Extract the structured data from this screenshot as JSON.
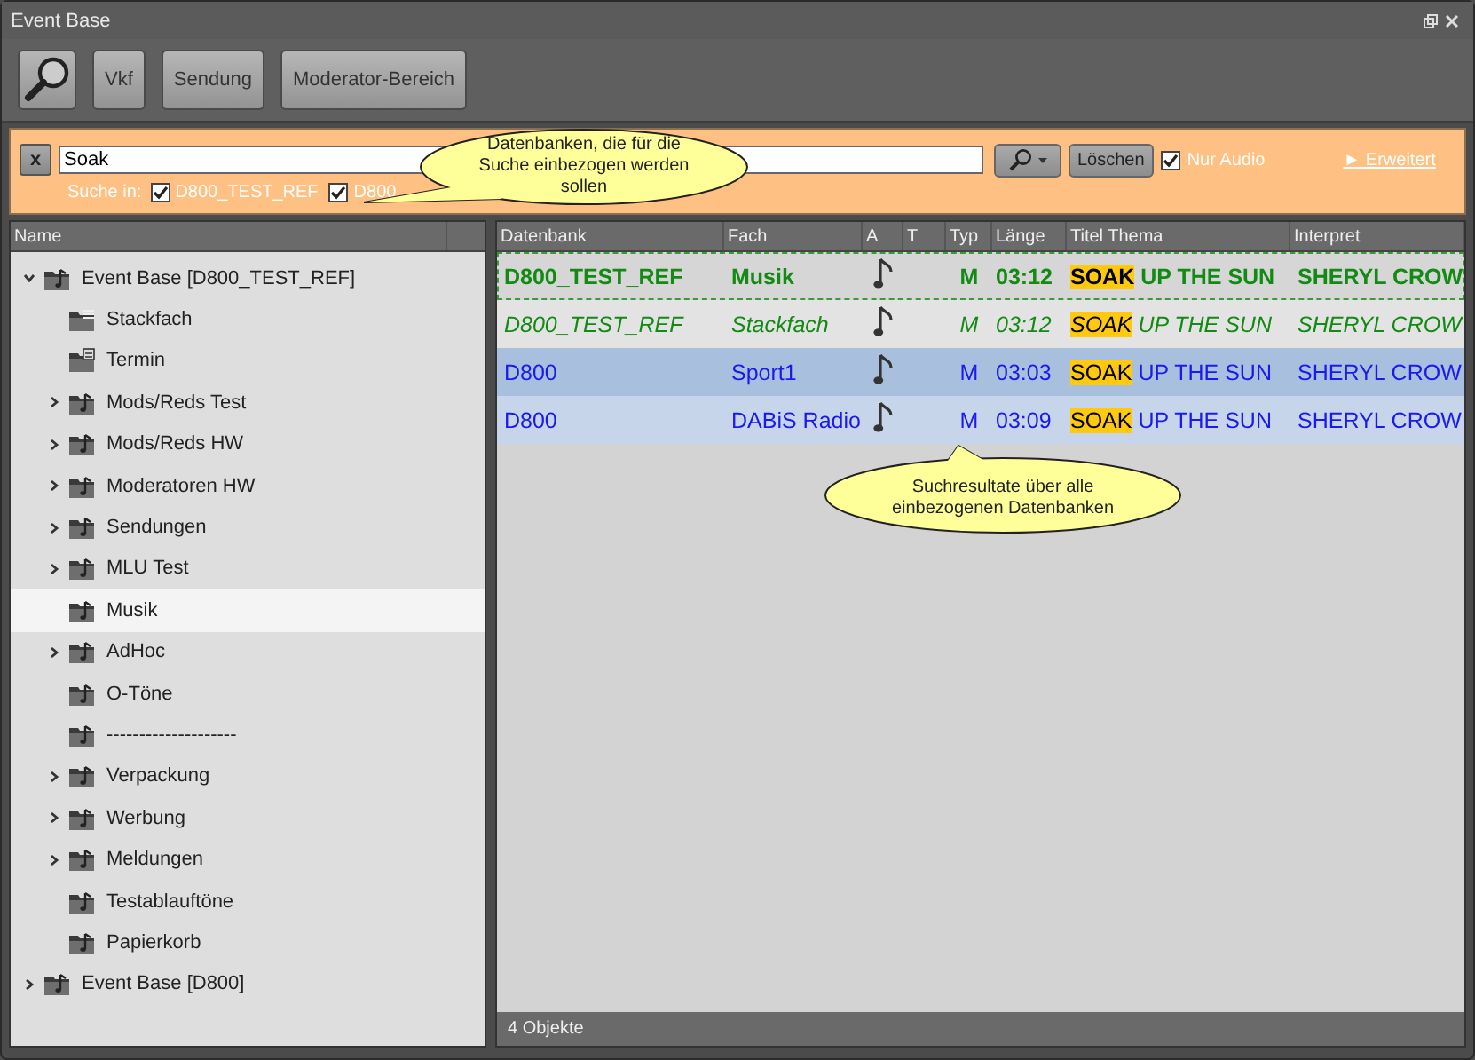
{
  "window": {
    "title": "Event Base"
  },
  "toolbar": {
    "buttons": [
      {
        "kind": "search"
      },
      {
        "kind": "text",
        "label": "Vkf"
      },
      {
        "kind": "text",
        "label": "Sendung"
      },
      {
        "kind": "text",
        "label": "Moderator-Bereich"
      }
    ]
  },
  "search": {
    "clear_label": "x",
    "value": "Soak",
    "delete_button": "Löschen",
    "audio_only": {
      "label": "Nur Audio",
      "checked": true
    },
    "advanced_link": "► Erweitert",
    "scope_label": "Suche in:",
    "databases": [
      {
        "label": "D800_TEST_REF",
        "checked": true
      },
      {
        "label": "D800",
        "checked": true
      }
    ]
  },
  "tree": {
    "column": "Name",
    "items": [
      {
        "label": "Event Base [D800_TEST_REF]",
        "kind": "music",
        "expanded": true,
        "selected": false,
        "children": [
          {
            "label": "Stackfach",
            "kind": "list",
            "selected": false
          },
          {
            "label": "Termin",
            "kind": "calendar",
            "selected": false
          },
          {
            "label": "Mods/Reds Test",
            "kind": "music",
            "expanded": false,
            "selected": false
          },
          {
            "label": "Mods/Reds HW",
            "kind": "music",
            "expanded": false,
            "selected": false
          },
          {
            "label": "Moderatoren HW",
            "kind": "music",
            "expanded": false,
            "selected": false
          },
          {
            "label": "Sendungen",
            "kind": "music",
            "expanded": false,
            "selected": false
          },
          {
            "label": "MLU Test",
            "kind": "music",
            "expanded": false,
            "selected": false
          },
          {
            "label": "Musik",
            "kind": "music",
            "selected": true
          },
          {
            "label": "AdHoc",
            "kind": "music",
            "expanded": false,
            "selected": false
          },
          {
            "label": "O-Töne",
            "kind": "music",
            "selected": false
          },
          {
            "label": "--------------------",
            "kind": "music",
            "selected": false
          },
          {
            "label": "Verpackung",
            "kind": "music",
            "expanded": false,
            "selected": false
          },
          {
            "label": "Werbung",
            "kind": "music",
            "expanded": false,
            "selected": false
          },
          {
            "label": "Meldungen",
            "kind": "music",
            "expanded": false,
            "selected": false
          },
          {
            "label": "Testablauftöne",
            "kind": "music",
            "selected": false
          },
          {
            "label": "Papierkorb",
            "kind": "music",
            "selected": false
          }
        ]
      },
      {
        "label": "Event Base [D800]",
        "kind": "music",
        "expanded": false,
        "selected": false
      }
    ]
  },
  "results": {
    "columns": [
      "Datenbank",
      "Fach",
      "A",
      "T",
      "Typ",
      "Länge",
      "Titel Thema",
      "Interpret"
    ],
    "rows": [
      {
        "database": "D800_TEST_REF",
        "subject": "Musik",
        "type": "M",
        "length": "03:12",
        "title_match": "SOAK",
        "title_rest": "UP THE SUN",
        "artist": "SHERYL CROW",
        "color": "#138a13",
        "kind": "bold",
        "selected": false,
        "focused": true
      },
      {
        "database": "D800_TEST_REF",
        "subject": "Stackfach",
        "type": "M",
        "length": "03:12",
        "title_match": "SOAK",
        "title_rest": "UP THE SUN",
        "artist": "SHERYL CROW",
        "color": "#138a13",
        "kind": "italic",
        "selected": false,
        "focused": false
      },
      {
        "database": "D800",
        "subject": "Sport1",
        "type": "M",
        "length": "03:03",
        "title_match": "SOAK",
        "title_rest": "UP THE SUN",
        "artist": "SHERYL CROW",
        "color": "#1a1aee",
        "kind": "plain",
        "selected": true,
        "focused": false
      },
      {
        "database": "D800",
        "subject": "DABiS Radio",
        "type": "M",
        "length": "03:09",
        "title_match": "SOAK",
        "title_rest": "UP THE SUN",
        "artist": "SHERYL CROW",
        "color": "#1a1aee",
        "kind": "plain",
        "selected": false,
        "focused": false
      }
    ],
    "status": "4 Objekte"
  },
  "callouts": [
    {
      "text": "Datenbanken, die für die Suche einbezogen werden sollen"
    },
    {
      "text": "Suchresultate über alle einbezogenen Datenbanken"
    }
  ]
}
